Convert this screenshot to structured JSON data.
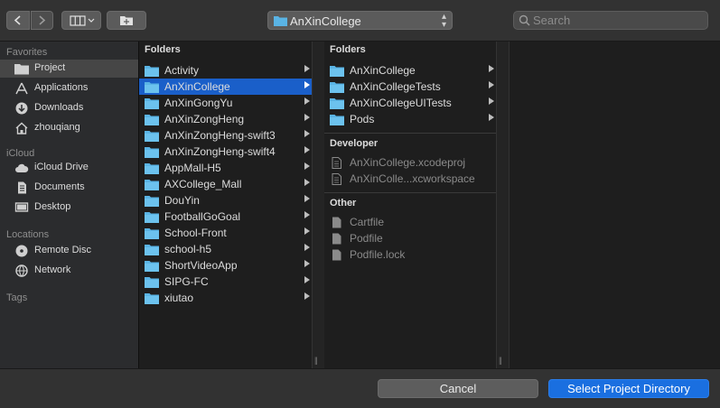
{
  "toolbar": {
    "back_icon": "chevron-left-icon",
    "forward_icon": "chevron-right-icon",
    "view_icon": "column-view-icon",
    "new_folder_icon": "new-folder-icon",
    "path_label": "AnXinCollege",
    "search_placeholder": "Search"
  },
  "sidebar": {
    "favorites_label": "Favorites",
    "favorites": [
      {
        "label": "Project",
        "icon": "folder-icon",
        "selected": true
      },
      {
        "label": "Applications",
        "icon": "applications-icon"
      },
      {
        "label": "Downloads",
        "icon": "downloads-icon"
      },
      {
        "label": "zhouqiang",
        "icon": "home-icon"
      }
    ],
    "icloud_label": "iCloud",
    "icloud": [
      {
        "label": "iCloud Drive",
        "icon": "cloud-icon"
      },
      {
        "label": "Documents",
        "icon": "document-icon"
      },
      {
        "label": "Desktop",
        "icon": "desktop-icon"
      }
    ],
    "locations_label": "Locations",
    "locations": [
      {
        "label": "Remote Disc",
        "icon": "disc-icon"
      },
      {
        "label": "Network",
        "icon": "network-icon"
      }
    ],
    "tags_label": "Tags"
  },
  "column1": {
    "header": "Folders",
    "items": [
      "Activity",
      "AnXinCollege",
      "AnXinGongYu",
      "AnXinZongHeng",
      "AnXinZongHeng-swift3",
      "AnXinZongHeng-swift4",
      "AppMall-H5",
      "AXCollege_Mall",
      "DouYin",
      "FootballGoGoal",
      "School-Front",
      "school-h5",
      "ShortVideoApp",
      "SIPG-FC",
      "xiutao"
    ],
    "selected_index": 1
  },
  "column2": {
    "folders_header": "Folders",
    "folders": [
      "AnXinCollege",
      "AnXinCollegeTests",
      "AnXinCollegeUITests",
      "Pods"
    ],
    "developer_header": "Developer",
    "developer": [
      "AnXinCollege.xcodeproj",
      "AnXinColle...xcworkspace"
    ],
    "other_header": "Other",
    "other": [
      "Cartfile",
      "Podfile",
      "Podfile.lock"
    ]
  },
  "buttons": {
    "cancel": "Cancel",
    "select": "Select Project Directory"
  },
  "colors": {
    "selection": "#1a5fc9",
    "primary_button": "#1a6fe0",
    "folder": "#5ab4e5"
  }
}
